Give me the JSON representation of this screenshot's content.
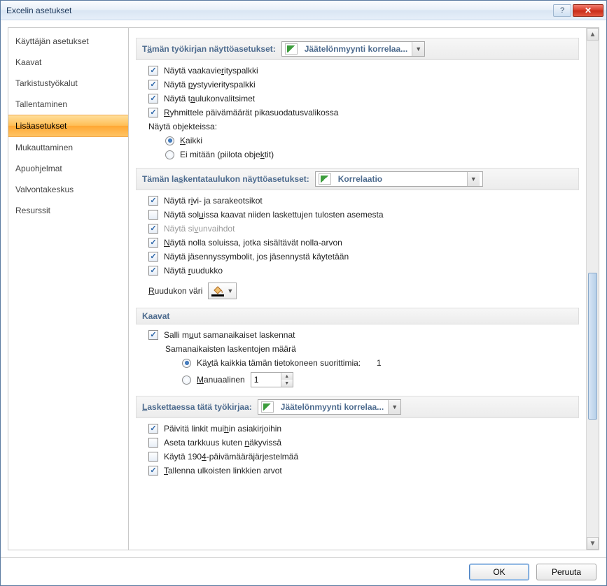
{
  "window": {
    "title": "Excelin asetukset"
  },
  "sidebar": {
    "items": [
      "Käyttäjän asetukset",
      "Kaavat",
      "Tarkistustyökalut",
      "Tallentaminen",
      "Lisäasetukset",
      "Mukauttaminen",
      "Apuohjelmat",
      "Valvontakeskus",
      "Resurssit"
    ],
    "selected_index": 4
  },
  "sections": {
    "workbook_display": {
      "label_pre": "T",
      "label_u": "ä",
      "label_post": "män työkirjan näyttöasetukset:",
      "dropdown": "Jäätelönmyynti korrelaa...",
      "opts": {
        "h_scroll": {
          "pre": "Näytä vaakavie",
          "u": "r",
          "post": "ityspalkki",
          "checked": true
        },
        "v_scroll": {
          "pre": "Näytä ",
          "u": "p",
          "post": "ystyvierityspalkki",
          "checked": true
        },
        "sheet_tabs": {
          "pre": "Näytä t",
          "u": "a",
          "post": "ulukonvalitsimet",
          "checked": true
        },
        "group_dates": {
          "pre": "",
          "u": "R",
          "post": "yhmittele päivämäärät pikasuodatusvalikossa",
          "checked": true
        },
        "objects_label": "Näytä objekteissa:",
        "objects_all": {
          "u": "K",
          "post": "aikki",
          "selected": true
        },
        "objects_none": {
          "pre": "Ei mitään (piilota obje",
          "u": "k",
          "post": "tit)",
          "selected": false
        }
      }
    },
    "worksheet_display": {
      "label_pre": "Tämän la",
      "label_u": "s",
      "label_post": "kentataulukon näyttöasetukset:",
      "dropdown": "Korrelaatio",
      "opts": {
        "headers": {
          "pre": "Näytä r",
          "u": "i",
          "post": "vi- ja sarakeotsikot",
          "checked": true
        },
        "show_formulas": {
          "pre": "Näytä sol",
          "u": "u",
          "post": "issa kaavat niiden laskettujen tulosten asemesta",
          "checked": false
        },
        "page_breaks": {
          "pre": "Näytä si",
          "u": "v",
          "post": "unvaihdot",
          "checked": true,
          "disabled": true
        },
        "show_zero": {
          "u": "N",
          "post": "äytä nolla soluissa, jotka sisältävät nolla-arvon",
          "checked": true
        },
        "outline": {
          "pre": "Näytä jäsennyssymbolit, jos jäsennystä käytetään",
          "checked": true
        },
        "gridlines": {
          "pre": "Näytä ",
          "u": "r",
          "post": "uudukko",
          "checked": true
        },
        "grid_color_label": {
          "u": "R",
          "post": "uudukon väri"
        }
      }
    },
    "formulas": {
      "label": "Kaavat",
      "multi_thread": {
        "pre": "Salli m",
        "u": "u",
        "post": "ut samanaikaiset laskennat",
        "checked": true
      },
      "thread_count_label": "Samanaikaisten laskentojen määrä",
      "use_all": {
        "pre": "Kä",
        "u": "y",
        "post": "tä kaikkia tämän tietokoneen suorittimia:",
        "value": "1",
        "selected": true
      },
      "manual": {
        "u": "M",
        "post": "anuaalinen",
        "value": "1",
        "selected": false
      }
    },
    "calculating": {
      "label_u": "L",
      "label_post": "askettaessa tätä työkirjaa:",
      "dropdown": "Jäätelönmyynti korrelaa...",
      "opts": {
        "update_links": {
          "pre": "Päivitä linkit mui",
          "u": "h",
          "post": "in asiakirjoihin",
          "checked": true
        },
        "precision": {
          "pre": "Aseta tarkkuus kuten ",
          "u": "n",
          "post": "äkyvissä",
          "checked": false
        },
        "date1904": {
          "pre": "Käytä 190",
          "u": "4",
          "post": "-päivämääräjärjestelmää",
          "checked": false
        },
        "save_ext_links": {
          "u": "T",
          "post": "allenna ulkoisten linkkien arvot",
          "checked": true
        }
      }
    }
  },
  "footer": {
    "ok": "OK",
    "cancel": "Peruuta"
  }
}
